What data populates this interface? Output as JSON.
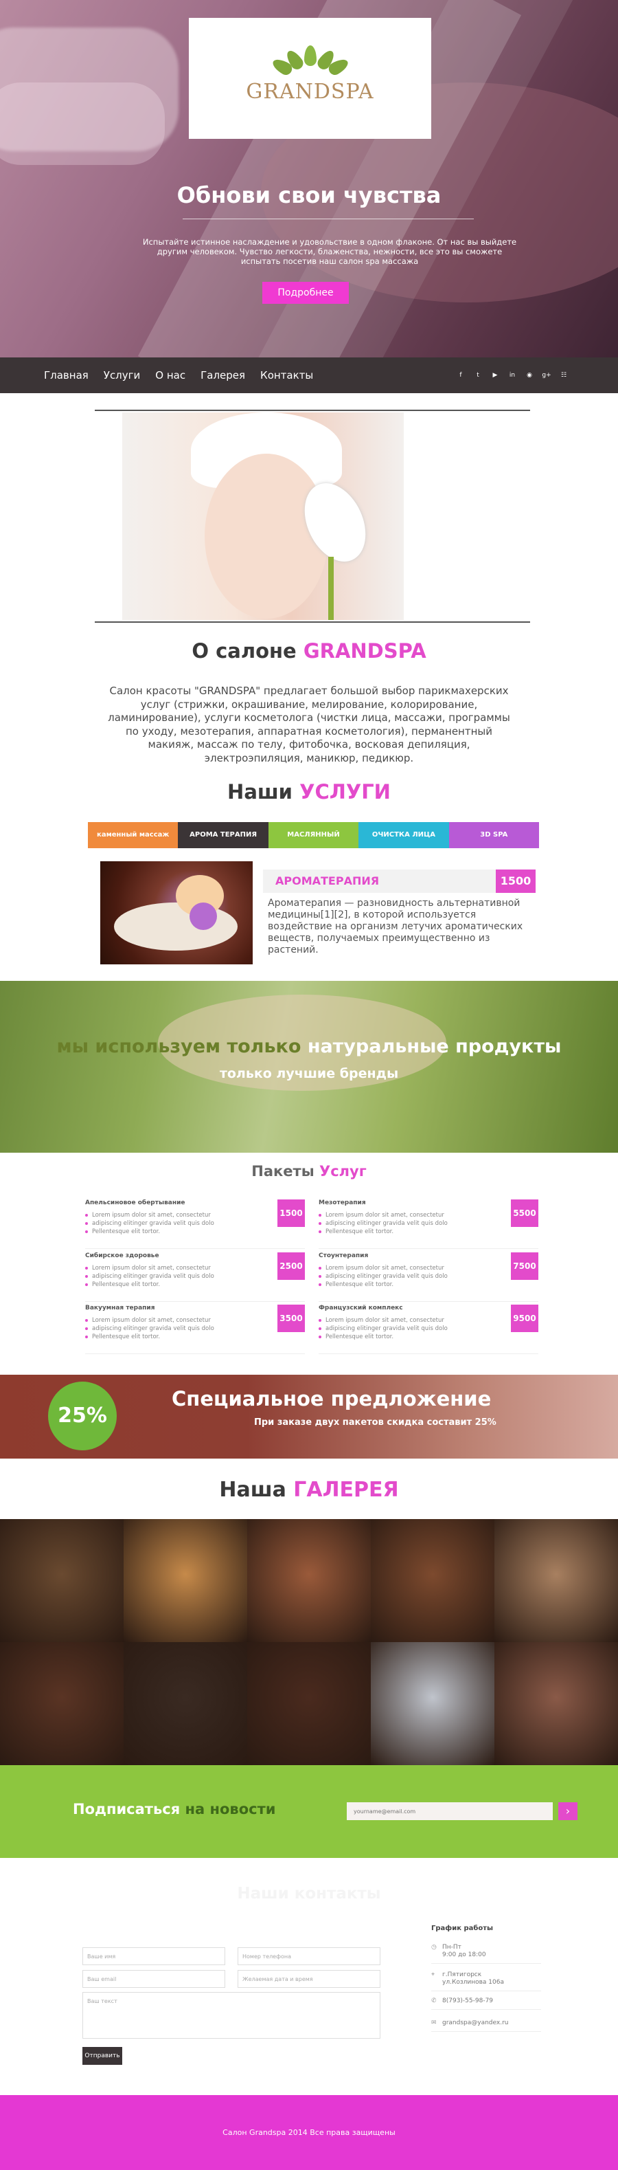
{
  "brand": {
    "logo_text": "GRANDSPA"
  },
  "hero": {
    "title": "Обнови свои чувства",
    "text": "Испытайте истинное наслаждение и удовольствие в одном флаконе. От нас вы выйдете другим человеком. Чувство легкости, блаженства, нежности, все это вы сможете испытать посетив наш салон spa массажа",
    "button": "Подробнее"
  },
  "nav": {
    "items": [
      "Главная",
      "Услуги",
      "О нас",
      "Галерея",
      "Контакты"
    ],
    "social": [
      "f",
      "t",
      "▶",
      "in",
      "◉",
      "g+",
      "☷"
    ]
  },
  "about": {
    "title_plain": "О салоне ",
    "title_accent": "GRANDSPA",
    "text": "Салон красоты \"GRANDSPA\" предлагает большой выбор парикмахерских услуг (стрижки, окрашивание, мелирование, колорирование, ламинирование), услуги косметолога (чистки лица, массажи, программы по уходу, мезотерапия, аппаратная косметология), перманентный макияж, массаж по телу, фитобочка, восковая депиляция, электроэпиляция, маникюр, педикюр."
  },
  "services": {
    "title_plain": "Наши ",
    "title_accent": "УСЛУГИ",
    "tabs": [
      {
        "label": "каменный массаж",
        "color": "#f08a3c"
      },
      {
        "label": "АРОМА ТЕРАПИЯ",
        "color": "#3b3436"
      },
      {
        "label": "МАСЛЯННЫЙ МАССАЖ",
        "color": "#8dc63f"
      },
      {
        "label": "ОЧИСТКА ЛИЦА",
        "color": "#2ab7d6"
      },
      {
        "label": "3D SPA",
        "color": "#b85ad6"
      }
    ],
    "active_title": "АРОМАТЕРАПИЯ",
    "active_price": "1500",
    "active_text": "Ароматерапия  — разновидность альтернативной медицины[1][2], в которой используется воздействие на организм летучих ароматических веществ, получаемых преимущественно из растений."
  },
  "natural": {
    "line1_a": "мы используем только ",
    "line1_b": "натуральные продукты",
    "line2": "только лучшие бренды"
  },
  "packages": {
    "title_plain": "Пакеты ",
    "title_accent": "Услуг",
    "items": [
      {
        "name": "Апельсиновое обертывание",
        "price": "1500",
        "lines": [
          "Lorem ipsum dolor sit amet, consectetur",
          "adipiscing elitinger gravida velit quis dolo",
          "Pellentesque elit tortor."
        ]
      },
      {
        "name": "Мезотерапия",
        "price": "5500",
        "lines": [
          "Lorem ipsum dolor sit amet, consectetur",
          "adipiscing elitinger gravida velit quis dolo",
          "Pellentesque elit tortor."
        ]
      },
      {
        "name": "Сибирское здоровье",
        "price": "2500",
        "lines": [
          "Lorem ipsum dolor sit amet, consectetur",
          "adipiscing elitinger gravida velit quis dolo",
          "Pellentesque elit tortor."
        ]
      },
      {
        "name": "Стоунтерапия",
        "price": "7500",
        "lines": [
          "Lorem ipsum dolor sit amet, consectetur",
          "adipiscing elitinger gravida velit quis dolo",
          "Pellentesque elit tortor."
        ]
      },
      {
        "name": "Вакуумная терапия",
        "price": "3500",
        "lines": [
          "Lorem ipsum dolor sit amet, consectetur",
          "adipiscing elitinger gravida velit quis dolo",
          "Pellentesque elit tortor."
        ]
      },
      {
        "name": "Французский комплекс",
        "price": "9500",
        "lines": [
          "Lorem ipsum dolor sit amet, consectetur",
          "adipiscing elitinger gravida velit quis dolo",
          "Pellentesque elit tortor."
        ]
      }
    ]
  },
  "offer": {
    "percent": "25%",
    "title": "Специальное предложение",
    "text": "При заказе двух пакетов скидка составит 25%"
  },
  "gallery": {
    "title_plain": "Наша ",
    "title_accent": "ГАЛЕРЕЯ",
    "tiles": [
      "#6a4a30",
      "#c68a4a",
      "#9a5a3a",
      "#7d4a2e",
      "#a88060",
      "#5a3424",
      "#3a2a22",
      "#4a2a1e",
      "#c0c4cc",
      "#8a5a48"
    ]
  },
  "subscribe": {
    "title_a": "Подписаться ",
    "title_b": "на новости",
    "placeholder": "yourname@email.com",
    "button": "›"
  },
  "contacts": {
    "title": "Наши контакты",
    "fields": {
      "name": "Ваше имя",
      "phone": "Номер телефона",
      "email": "Ваш email",
      "datetime": "Желаемая дата и время",
      "message": "Ваш текст"
    },
    "send": "Отправить",
    "schedule_title": "График работы",
    "items": [
      {
        "icon": "◷",
        "text": "Пн-Пт\n9:00 до 18:00"
      },
      {
        "icon": "⌖",
        "text": "г.Пятигорск\nул.Козлинова 106а"
      },
      {
        "icon": "✆",
        "text": "8(793)-55-98-79"
      },
      {
        "icon": "✉",
        "text": "grandspa@yandex.ru"
      }
    ]
  },
  "footer": {
    "text": "Салон Grandspa 2014  Все права защищены"
  }
}
